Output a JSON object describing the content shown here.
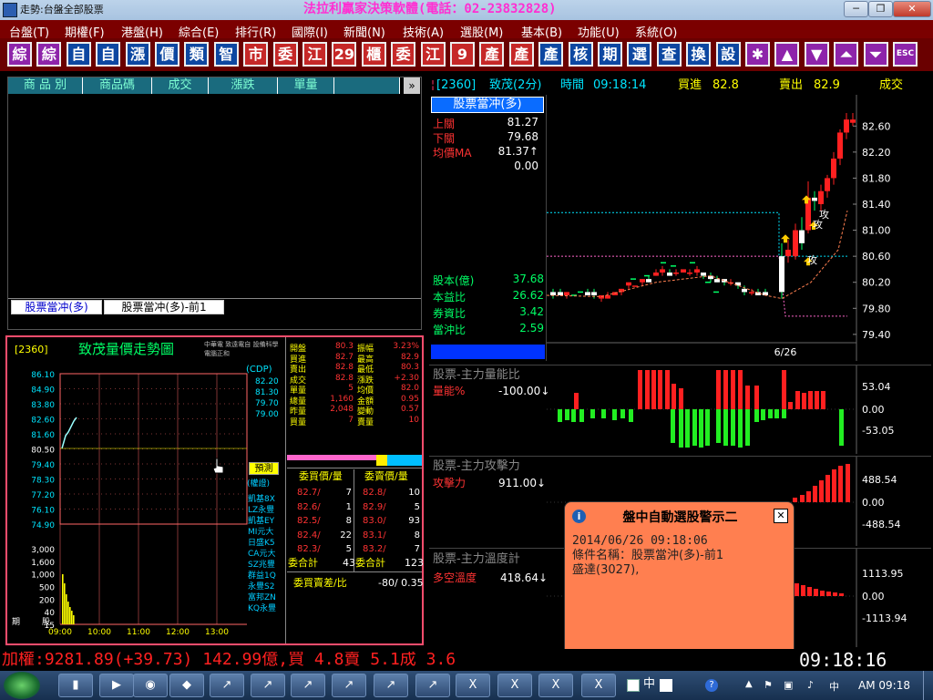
{
  "window": {
    "title": "走勢:台盤全部股票",
    "banner": "法拉利贏家決策軟體(電話：02-23832828)",
    "min_label": "─",
    "restore_label": "❐",
    "close_label": "✕"
  },
  "menus": [
    "台盤(T)",
    "期權(F)",
    "港盤(H)",
    "綜合(E)",
    "排行(R)",
    "國際(I)",
    "新聞(N)",
    "技術(A)",
    "選股(M)",
    "基本(B)",
    "功能(U)",
    "系統(O)"
  ],
  "toolbar": [
    {
      "label": "綜",
      "color": "mag"
    },
    {
      "label": "綜",
      "color": "mag"
    },
    {
      "label": "自",
      "color": "blue"
    },
    {
      "label": "自",
      "color": "blue"
    },
    {
      "label": "漲",
      "color": "blue"
    },
    {
      "label": "價",
      "color": "blue"
    },
    {
      "label": "類",
      "color": "blue"
    },
    {
      "label": "智",
      "color": "blue"
    },
    {
      "label": "市",
      "color": "red"
    },
    {
      "label": "委",
      "color": "red"
    },
    {
      "label": "江",
      "color": "red"
    },
    {
      "label": "29",
      "color": "red"
    },
    {
      "label": "櫃",
      "color": "red"
    },
    {
      "label": "委",
      "color": "red"
    },
    {
      "label": "江",
      "color": "red"
    },
    {
      "label": "9",
      "color": "red"
    },
    {
      "label": "產",
      "color": "red"
    },
    {
      "label": "產",
      "color": "red"
    },
    {
      "label": "產",
      "color": "blue"
    },
    {
      "label": "核",
      "color": "blue"
    },
    {
      "label": "期",
      "color": "blue"
    },
    {
      "label": "選",
      "color": "blue"
    },
    {
      "label": "查",
      "color": "blue"
    },
    {
      "label": "換",
      "color": "blue"
    },
    {
      "label": "設",
      "color": "blue"
    },
    {
      "label": "✱",
      "color": "mag"
    },
    {
      "label": "▲",
      "color": "mag"
    },
    {
      "label": "▼",
      "color": "mag"
    },
    {
      "label": "⏶",
      "color": "mag"
    },
    {
      "label": "⏷",
      "color": "mag"
    },
    {
      "label": "ESC",
      "color": "mag"
    }
  ],
  "topleft": {
    "headers": [
      "商 品 別",
      "商品碼",
      "成交",
      "漲跌",
      "單量"
    ],
    "scroll_btn": "»",
    "tabs": [
      "股票當冲(多)",
      "股票當冲(多)-前1"
    ]
  },
  "mini": {
    "code": "[2360]",
    "title": "致茂量價走勢圖",
    "note1": "中華電 致遠電自 設備科學",
    "note2": "電腦正和",
    "y_prices": [
      "86.10",
      "84.90",
      "83.80",
      "82.60",
      "81.60",
      "80.50",
      "79.40",
      "78.30",
      "77.20",
      "76.10",
      "74.90"
    ],
    "y_vol": [
      "3,000",
      "1,600",
      "1,000",
      "500",
      "200",
      "40",
      "15"
    ],
    "x_times": [
      "09:00",
      "10:00",
      "11:00",
      "12:00",
      "13:00"
    ],
    "corner_label_a": "期",
    "corner_label_b": "股",
    "cdp_label": "(CDP)",
    "cdp_vals": [
      "82.20",
      "81.30",
      "79.70",
      "79.00"
    ],
    "quote_rows": [
      [
        "開盤",
        "80.3",
        "振幅",
        "3.23%"
      ],
      [
        "買進",
        "82.7",
        "最高",
        "82.9"
      ],
      [
        "賣出",
        "82.8",
        "最低",
        "80.3"
      ],
      [
        "成交",
        "82.8",
        "漲跌",
        "+2.30"
      ],
      [
        "單量",
        "5",
        "均價",
        "82.0"
      ],
      [
        "總量",
        "1,160",
        "金額",
        "0.95"
      ],
      [
        "昨量",
        "2,048",
        "變動",
        "0.57"
      ],
      [
        "買量",
        "7",
        "賣量",
        "10"
      ]
    ],
    "forecast_btn": "預測",
    "related_label": "(權證)",
    "related": [
      "凱基8X",
      "LZ永豐",
      "凱基EY",
      "MI元大",
      "日盛K5",
      "CA元大",
      "SZ兆豐",
      "群益1Q",
      "永豐S2",
      "富邦ZN",
      "KQ永豐"
    ],
    "book_headers": [
      "委買價/量",
      "委賣價/量"
    ],
    "book_buy": [
      [
        "82.7/",
        "7"
      ],
      [
        "82.6/",
        "1"
      ],
      [
        "82.5/",
        "8"
      ],
      [
        "82.4/",
        "22"
      ],
      [
        "82.3/",
        "5"
      ]
    ],
    "book_sell": [
      [
        "82.8/",
        "10"
      ],
      [
        "82.9/",
        "5"
      ],
      [
        "83.0/",
        "93"
      ],
      [
        "83.1/",
        "8"
      ],
      [
        "83.2/",
        "7"
      ]
    ],
    "book_total_buy": [
      "委合計",
      "43"
    ],
    "book_total_sell": [
      "委合計",
      "123"
    ],
    "ratio_label": "委買賣差/比",
    "ratio_value": "-80/ 0.35"
  },
  "chart": {
    "header": {
      "code": "[2360]",
      "name": "致茂(2分)",
      "time_label": "時間",
      "time": "09:18:14",
      "buy_label": "買進",
      "buy": "82.8",
      "sell_label": "賣出",
      "sell": "82.9",
      "last_label": "成交"
    },
    "strategy_title": "股票當冲(多)",
    "levels": [
      [
        "上關",
        "81.27"
      ],
      [
        "下關",
        "79.68"
      ],
      [
        "均價MA",
        "81.37↑"
      ],
      [
        "",
        "0.00"
      ]
    ],
    "ratios": [
      [
        "股本(億)",
        "37.68"
      ],
      [
        "本益比",
        "26.62"
      ],
      [
        "券資比",
        "3.42"
      ],
      [
        "當沖比",
        "2.59"
      ]
    ],
    "y_axis": [
      "82.60",
      "82.20",
      "81.80",
      "81.40",
      "81.00",
      "80.60",
      "80.20",
      "79.80",
      "79.40"
    ],
    "date_label": "6/26",
    "attack_label": "攻",
    "sub1": {
      "title": "股票-主力量能比",
      "label": "量能%",
      "value": "-100.00↓",
      "ticks": [
        "53.04",
        "0.00",
        "-53.05"
      ]
    },
    "sub2": {
      "title": "股票-主力攻擊力",
      "label": "攻擊力",
      "value": "911.00↓",
      "ticks": [
        "488.54",
        "0.00",
        "-488.54"
      ]
    },
    "sub3": {
      "title": "股票-主力溫度計",
      "label": "多空溫度",
      "value": "418.64↓",
      "ticks": [
        "1113.95",
        "0.00",
        "-1113.94"
      ]
    }
  },
  "popup": {
    "title": "盤中自動選股警示二",
    "close": "✕",
    "lines": [
      "2014/06/26 09:18:06",
      "條件名稱：股票當沖(多)-前1",
      "盛達(3027),"
    ]
  },
  "status": {
    "ticker": "加權:9281.89(+39.73) 142.99億,買 4.8賣 5.1成 3.6",
    "clock": "09:18:16"
  },
  "taskbar": {
    "clock": "AM 09:18",
    "ime": "中"
  }
}
